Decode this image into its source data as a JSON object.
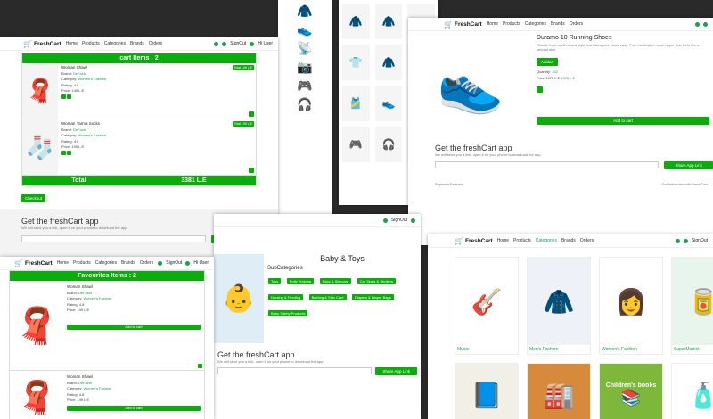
{
  "brand": "FreshCart",
  "nav": {
    "home": "Home",
    "products": "Products",
    "categories": "Categories",
    "brands": "Brands",
    "orders": "Orders",
    "signout": "SignOut",
    "user": "Hi User"
  },
  "cart": {
    "header": "cart Items : 2",
    "items": [
      {
        "title": "Woman Shawl",
        "brand_label": "Brand:",
        "brand": "DeFacto",
        "category_label": "Category:",
        "category": "Women's Fashion",
        "rating_label": "Rating:",
        "rating": "4.8",
        "price_label": "Price:",
        "price": "149 L.E",
        "total": "Total 149 L.E"
      },
      {
        "title": "Woman Yarma Socks",
        "brand_label": "Brand:",
        "brand": "DeFacto",
        "category_label": "Category:",
        "category": "Women's Fashion",
        "rating_label": "Rating:",
        "rating": "4.8",
        "price_label": "Price:",
        "price": "199 L.E",
        "total": "Total 199 L.E"
      }
    ],
    "total_label": "Total",
    "total_value": "3381 L.E",
    "checkout": "Checkout"
  },
  "app": {
    "title": "Get the freshCart app",
    "subtitle": "We will send you a link, open it on your phone to download the app.",
    "placeholder": "Email..",
    "button": "Share App Link",
    "payment": "Payment Partners",
    "delivery": "Get deliveries with FreshCart"
  },
  "product": {
    "title": "Duramo 10 Running Shoes",
    "desc": "Classic fresh understated style that takes your stride easy. Free breathable mesh upper that feels like a second skin.",
    "brand": "Adidas",
    "quantity_label": "Quantity:",
    "quantity": "152",
    "price": "Price:1475 L.E",
    "old_price": "1376 L.E",
    "add": "Add to cart"
  },
  "fav": {
    "header": "Favourites Items : 2",
    "items": [
      {
        "title": "Woman Shawl",
        "brand_label": "Brand:",
        "brand": "DeFacto",
        "category_label": "Category:",
        "category": "Women's Fashion",
        "rating_label": "Rating:",
        "rating": "4.8",
        "price_label": "Price:",
        "price": "149 L.E",
        "button": "Add to cart"
      },
      {
        "title": "Woman Shawl",
        "brand_label": "Brand:",
        "brand": "DeFacto",
        "category_label": "Category:",
        "category": "Women's Fashion",
        "rating_label": "Rating:",
        "rating": "4.8",
        "price_label": "Price:",
        "price": "149 L.E",
        "button": "Add to cart"
      }
    ]
  },
  "baby": {
    "title": "Baby & Toys",
    "sub": "SubCategories",
    "tags": [
      "Toys",
      "Potty Training",
      "Baby & Skincare",
      "Car Seats & Strollers",
      "Nursing & Feeding",
      "Bathing & Skin Care",
      "Diapers & Diaper Bags",
      "Baby Safety Products"
    ],
    "banner": "apers"
  },
  "categories": [
    {
      "label": "Music",
      "icon": "🎸"
    },
    {
      "label": "Men's Fashion",
      "icon": "🧥"
    },
    {
      "label": "Women's Fashion",
      "icon": "👩"
    },
    {
      "label": "SuperMarket",
      "icon": "🥫"
    }
  ],
  "categories_row2": [
    {
      "icon": "📘"
    },
    {
      "icon": "🏭"
    },
    {
      "label": "Children's books",
      "icon": "📚"
    },
    {
      "icon": "🧴"
    }
  ],
  "colors": {
    "accent": "#0aad0a"
  }
}
